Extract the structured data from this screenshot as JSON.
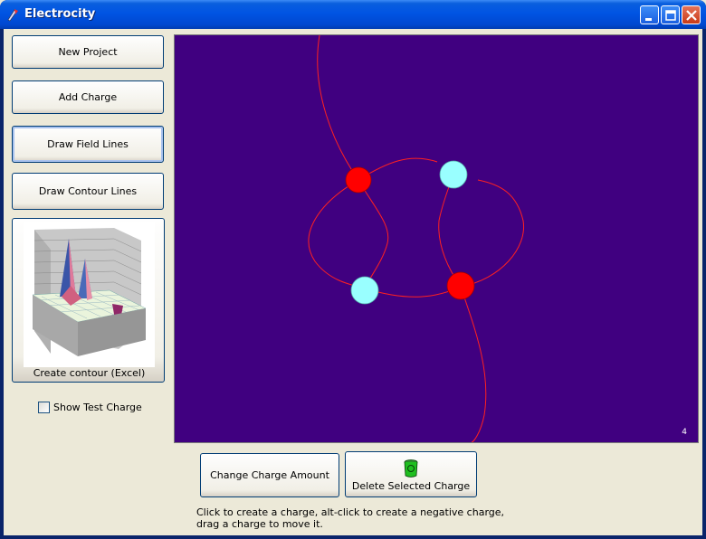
{
  "window": {
    "title": "Electrocity"
  },
  "sidebar": {
    "new_project": "New Project",
    "add_charge": "Add Charge",
    "draw_field_lines": "Draw Field Lines",
    "draw_contour_lines": "Draw Contour Lines",
    "create_contour": "Create contour (Excel)",
    "show_test_charge": "Show Test Charge",
    "show_test_charge_checked": false
  },
  "canvas": {
    "background": "#400080",
    "counter": "4",
    "charges": [
      {
        "sign": "positive",
        "color": "#ff0000"
      },
      {
        "sign": "negative",
        "color": "#99ffff"
      },
      {
        "sign": "negative",
        "color": "#99ffff"
      },
      {
        "sign": "positive",
        "color": "#ff0000"
      }
    ],
    "field_line_color": "#ff2020"
  },
  "bottom": {
    "change_charge_amount": "Change Charge Amount",
    "delete_selected_charge": "Delete Selected Charge",
    "instructions_line1": "Click to create a charge, alt-click to create a negative charge,",
    "instructions_line2": "drag a charge to move it."
  }
}
